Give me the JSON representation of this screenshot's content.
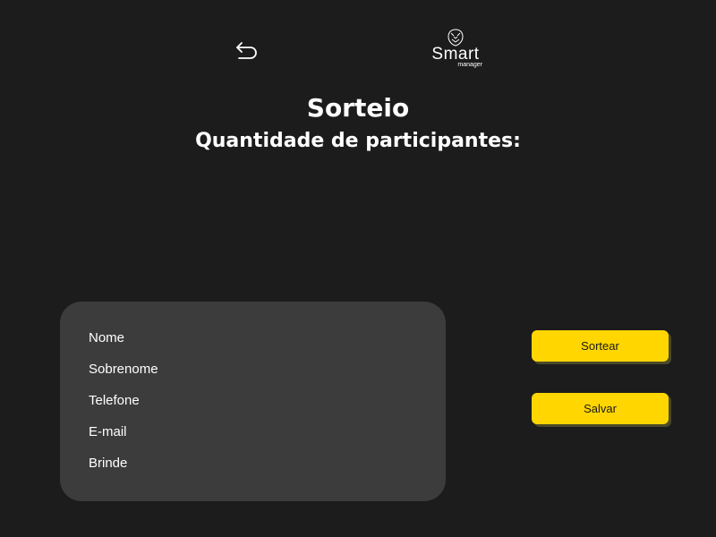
{
  "header": {
    "back_icon": "undo-arrow-icon",
    "logo": {
      "word": "Smart",
      "sub": "manager",
      "icon": "lion-head-icon"
    }
  },
  "main": {
    "title": "Sorteio",
    "subtitle": "Quantidade de participantes:"
  },
  "fields": {
    "items": [
      "Nome",
      "Sobrenome",
      "Telefone",
      "E-mail",
      "Brinde"
    ]
  },
  "actions": {
    "draw_label": "Sortear",
    "save_label": "Salvar",
    "accent_color": "#ffd600"
  },
  "colors": {
    "background": "#1c1c1c",
    "card": "#3c3c3c",
    "text": "#ffffff"
  }
}
